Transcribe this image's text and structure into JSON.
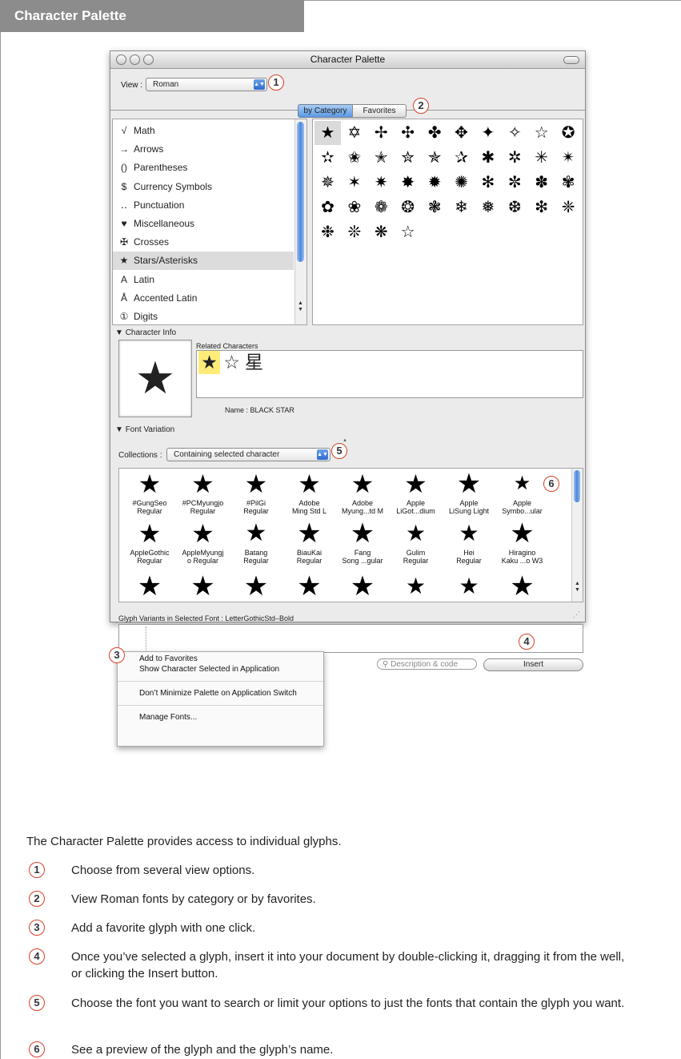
{
  "section_title": "Character Palette",
  "window": {
    "title": "Character Palette",
    "view_label": "View :",
    "view_value": "Roman",
    "segments": [
      "by Category",
      "Favorites"
    ],
    "categories": [
      {
        "icon": "√",
        "label": "Math"
      },
      {
        "icon": "→",
        "label": "Arrows"
      },
      {
        "icon": "()",
        "label": "Parentheses"
      },
      {
        "icon": "$",
        "label": "Currency Symbols"
      },
      {
        "icon": "‥",
        "label": "Punctuation"
      },
      {
        "icon": "♥",
        "label": "Miscellaneous"
      },
      {
        "icon": "✠",
        "label": "Crosses"
      },
      {
        "icon": "★",
        "label": "Stars/Asterisks"
      },
      {
        "icon": "A",
        "label": "Latin"
      },
      {
        "icon": "Å",
        "label": "Accented Latin"
      },
      {
        "icon": "①",
        "label": "Digits"
      }
    ],
    "glyphs": [
      "★",
      "✡",
      "✢",
      "✣",
      "✤",
      "✥",
      "✦",
      "✧",
      "☆",
      "✪",
      "✫",
      "✬",
      "✭",
      "✮",
      "✯",
      "✰",
      "✱",
      "✲",
      "✳",
      "✴",
      "✵",
      "✶",
      "✷",
      "✸",
      "✹",
      "✺",
      "✻",
      "✼",
      "✽",
      "✾",
      "✿",
      "❀",
      "❁",
      "❂",
      "❃",
      "❄",
      "❅",
      "❆",
      "❇",
      "❈",
      "❉",
      "❊",
      "❋",
      "☆"
    ],
    "character_info_label": "Character Info",
    "preview_glyph": "★",
    "related_label": "Related Characters",
    "related": [
      "★",
      "☆",
      "星"
    ],
    "name_line": "Name : BLACK STAR",
    "font_variation_label": "Font Variation",
    "collections_label": "Collections :",
    "collections_value": "Containing selected character",
    "fonts": [
      {
        "l1": "#GungSeo",
        "l2": "Regular"
      },
      {
        "l1": "#PCMyungjo",
        "l2": "Regular"
      },
      {
        "l1": "#PilGi",
        "l2": "Regular"
      },
      {
        "l1": "Adobe",
        "l2": "Ming Std L"
      },
      {
        "l1": "Adobe",
        "l2": "Myung...td M"
      },
      {
        "l1": "Apple",
        "l2": "LiGot...dium"
      },
      {
        "l1": "Apple",
        "l2": "LiSung Light"
      },
      {
        "l1": "Apple",
        "l2": "Symbo...ular"
      },
      {
        "l1": "AppleGothic",
        "l2": "Regular"
      },
      {
        "l1": "AppleMyungj",
        "l2": "o Regular"
      },
      {
        "l1": "Batang",
        "l2": "Regular"
      },
      {
        "l1": "BiauKai",
        "l2": "Regular"
      },
      {
        "l1": "Fang",
        "l2": "Song ...gular"
      },
      {
        "l1": "Gulim",
        "l2": "Regular"
      },
      {
        "l1": "Hei",
        "l2": "Regular"
      },
      {
        "l1": "Hiragino",
        "l2": "Kaku ...o W3"
      }
    ],
    "font_glyph": "★",
    "variants_label": "Glyph Variants in Selected Font : LetterGothicStd–Bold",
    "gear_label": "✲▾",
    "search_placeholder": "Description & code",
    "insert_label": "Insert"
  },
  "menu": {
    "items": [
      "Add to Favorites",
      "Show Character Selected in Application",
      "Don’t Minimize Palette on Application Switch",
      "Manage Fonts..."
    ]
  },
  "callouts": [
    "1",
    "2",
    "3",
    "4",
    "5",
    "6"
  ],
  "intro": "The Character Palette provides access to individual glyphs.",
  "items": [
    {
      "num": "1",
      "text": "Choose from several view options."
    },
    {
      "num": "2",
      "text": "View Roman fonts by category or by favorites."
    },
    {
      "num": "3",
      "text": "Add a favorite glyph with one click."
    },
    {
      "num": "4",
      "text": "Once you’ve selected a glyph, insert it into your document by double-clicking it, dragging it from the well, or clicking the Insert button."
    },
    {
      "num": "5",
      "text": "Choose the font you want to search or limit your options to just the fonts that contain the glyph you want."
    },
    {
      "num": "6",
      "text": "See a preview of the glyph and the glyph’s name."
    }
  ],
  "accent_color": "#d9412a"
}
